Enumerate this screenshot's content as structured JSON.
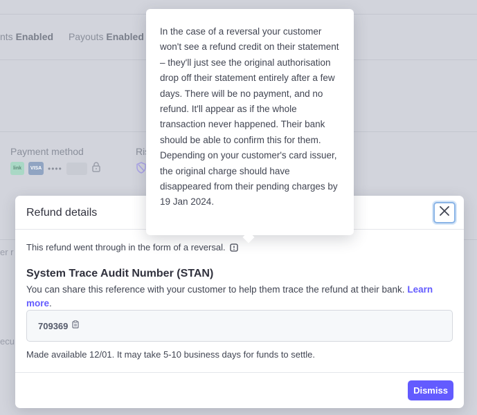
{
  "background": {
    "status_items": [
      {
        "label": "nts",
        "value": "Enabled"
      },
      {
        "label": "Payouts",
        "value": "Enabled"
      }
    ],
    "payment_method_label": "Payment method",
    "risk_label": "Ris",
    "card_dots": "••••",
    "badge_link": "link",
    "badge_visa": "VISA",
    "side_text_1": "er r",
    "side_text_2": "ecu"
  },
  "modal": {
    "title": "Refund details",
    "reversal_text": "This refund went through in the form of a reversal.",
    "stan_heading": "System Trace Audit Number (STAN)",
    "stan_description": "You can share this reference with your customer to help them trace the refund at their bank.",
    "learn_more": "Learn more",
    "learn_more_suffix": ".",
    "stan_value": "709369",
    "made_available": "Made available 12/01. It may take 5-10 business days for funds to settle.",
    "dismiss_label": "Dismiss"
  },
  "tooltip": {
    "text": "In the case of a reversal your customer won't see a refund credit on their statement – they'll just see the original authorisation drop off their statement entirely after a few days. There will be no payment, and no refund. It'll appear as if the whole transaction never happened. Their bank should be able to confirm this for them. Depending on your customer's card issuer, the original charge should have disappeared from their pending charges by",
    "date": "19 Jan 2024."
  },
  "colors": {
    "accent": "#635bff",
    "overlay": "#d2d4dc",
    "focus_ring": "#8ab4e6"
  }
}
